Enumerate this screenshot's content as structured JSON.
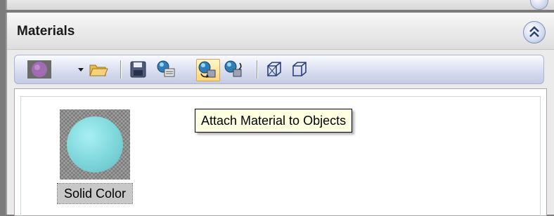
{
  "panel": {
    "title": "Materials"
  },
  "toolbar": {
    "items": [
      {
        "name": "material-swatch-button",
        "icon": "purple-sphere-swatch"
      },
      {
        "name": "dropdown-arrow",
        "icon": "chevron-down"
      },
      {
        "name": "open-library-button",
        "icon": "folder-open"
      },
      {
        "name": "save-button",
        "icon": "floppy-disk"
      },
      {
        "name": "get-material-button",
        "icon": "material-get"
      },
      {
        "name": "attach-material-button",
        "icon": "material-attach",
        "highlighted": true
      },
      {
        "name": "detach-material-button",
        "icon": "material-detach"
      },
      {
        "name": "display-wireframe-button",
        "icon": "wire-cube"
      },
      {
        "name": "display-shaded-button",
        "icon": "cube-outline"
      }
    ]
  },
  "tooltip": {
    "text": "Attach Material to Objects"
  },
  "materials": [
    {
      "name": "Solid Color",
      "color": "#7dd6da",
      "selected": true
    }
  ]
}
